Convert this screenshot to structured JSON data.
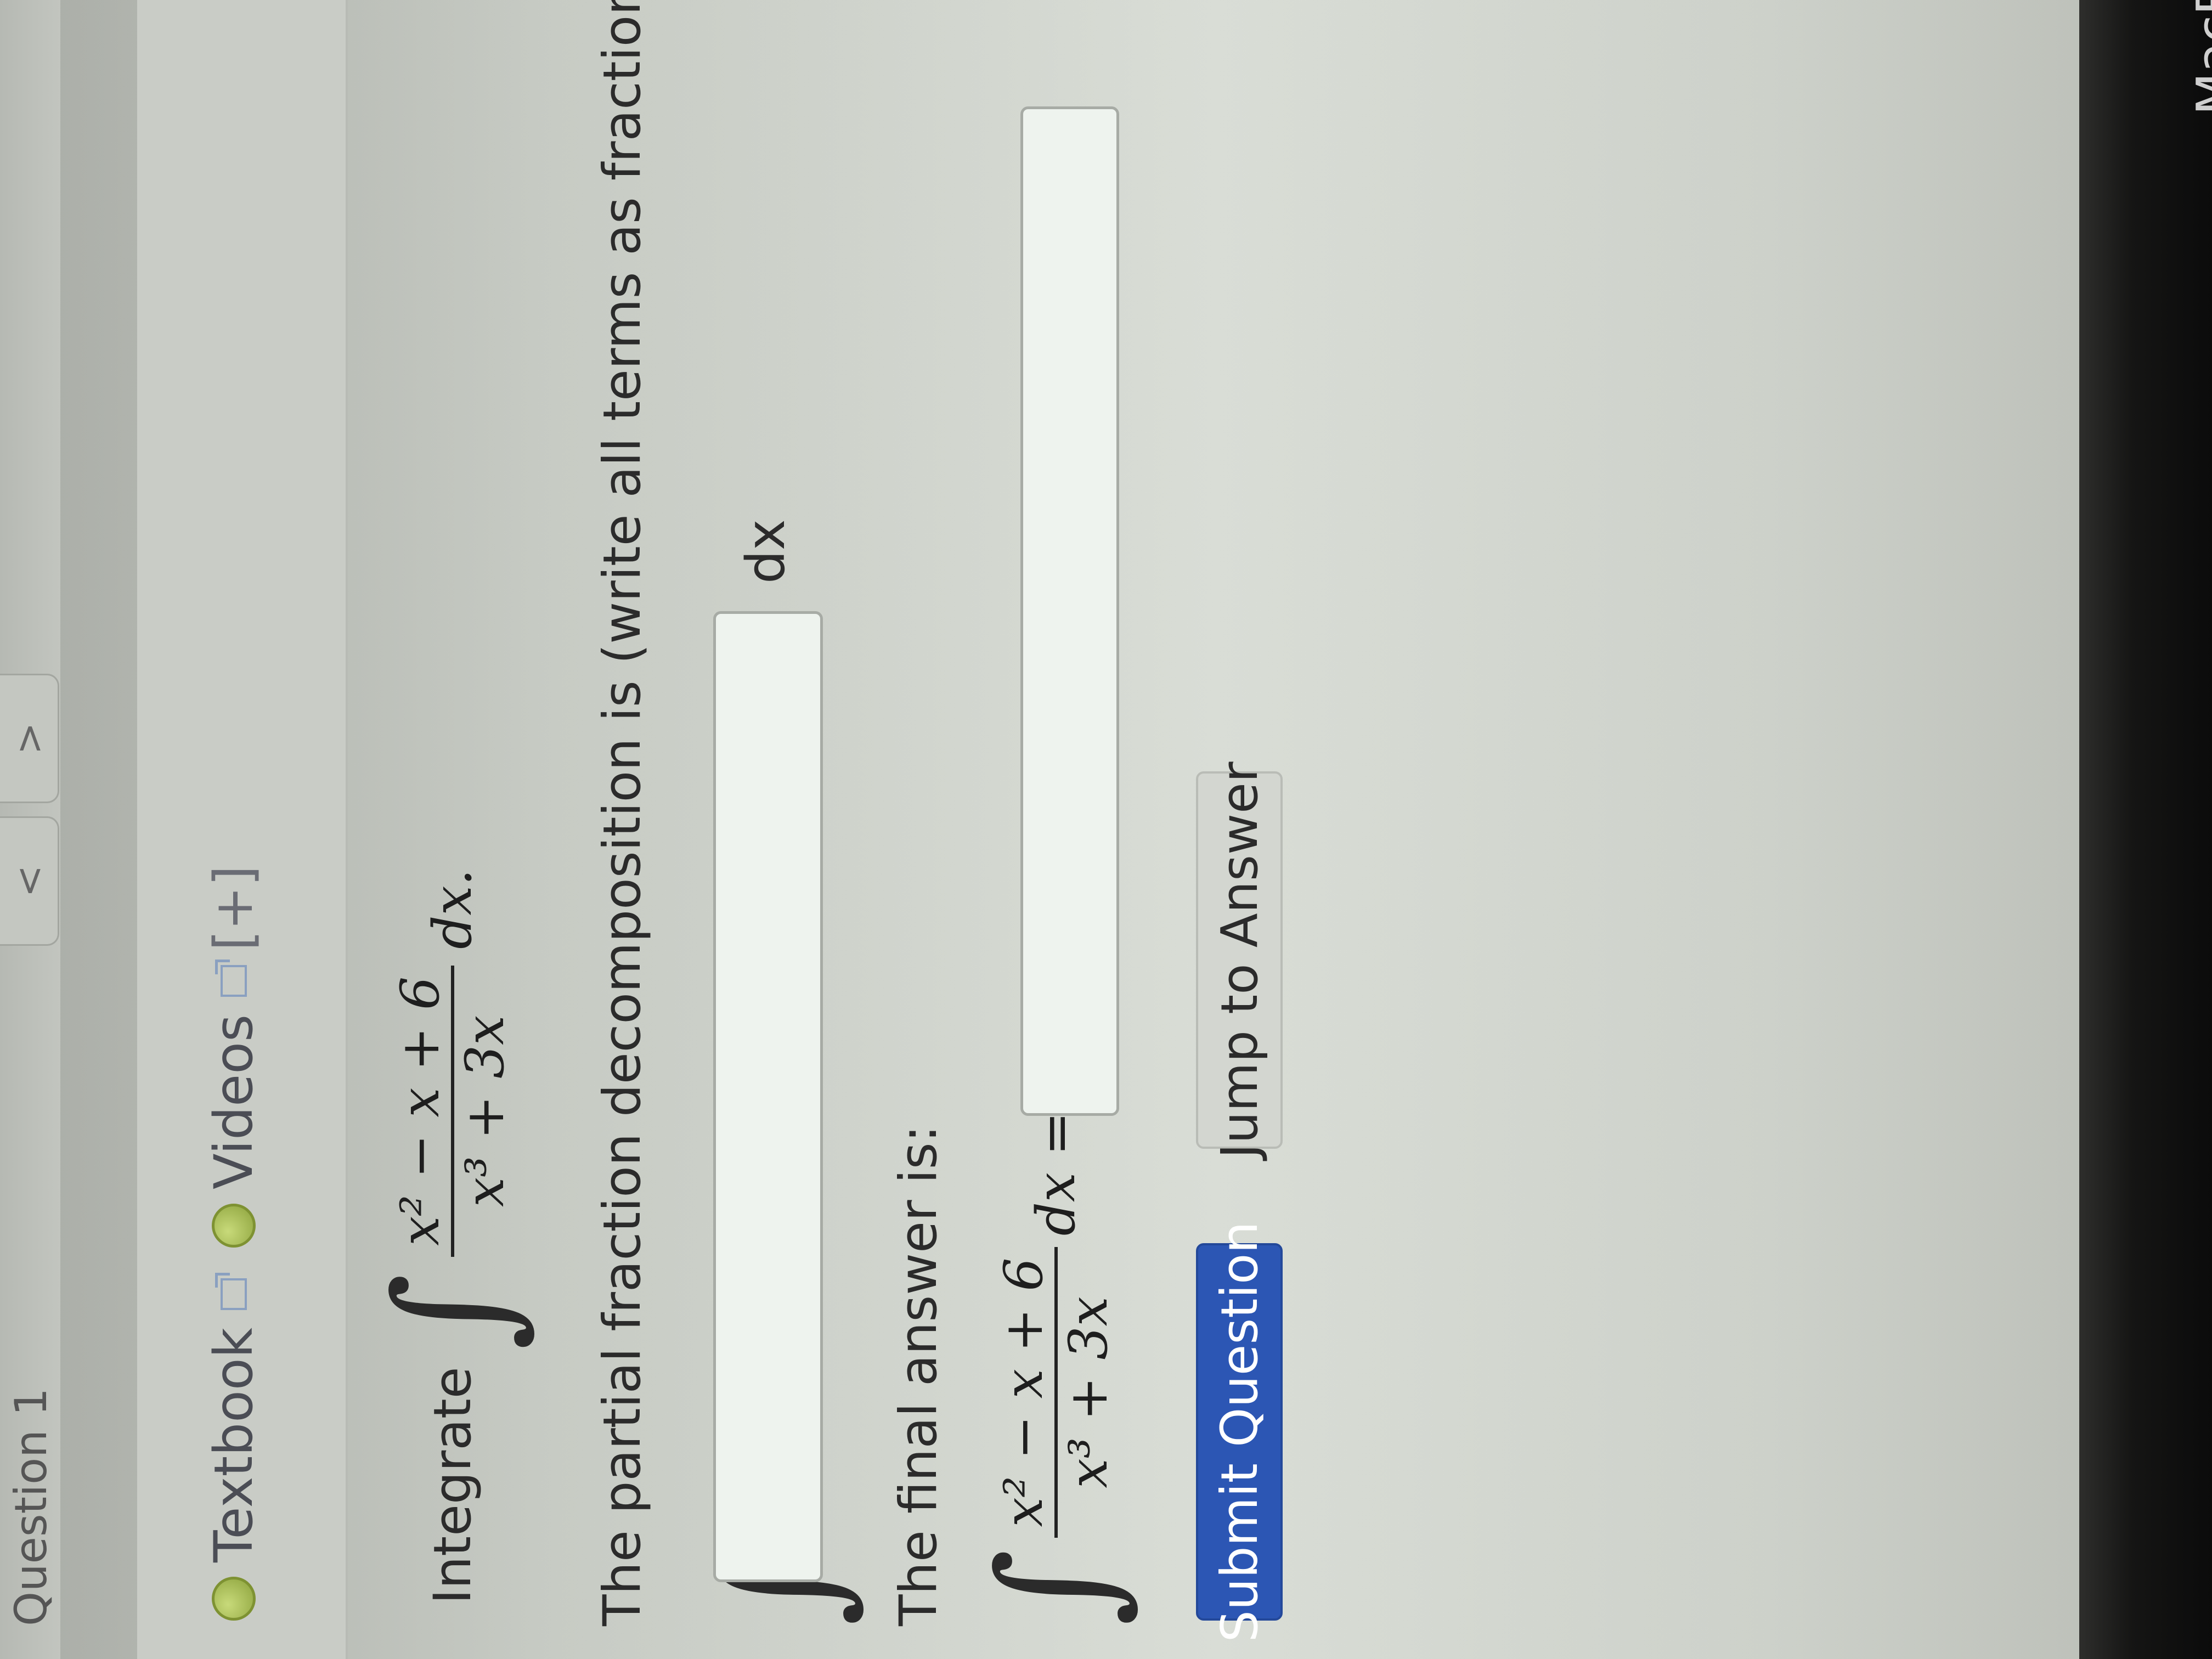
{
  "header": {
    "question_label": "Question 1",
    "tab_prev": "<",
    "tab_next": ">"
  },
  "toolbar": {
    "textbook_label": "Textbook",
    "videos_label": "Videos",
    "videos_expand": "[+]"
  },
  "problem": {
    "prompt_word": "Integrate",
    "numerator": "x² − x + 6",
    "denominator": "x³ + 3x",
    "differential": "dx."
  },
  "partial_fraction": {
    "instruction": "The partial fraction decomposition is (write all terms as fractions):",
    "input_value": "",
    "suffix": "dx"
  },
  "final_answer": {
    "label": "The final answer is:",
    "numerator": "x² − x + 6",
    "denominator": "x³ + 3x",
    "differential": "dx =",
    "input_value": ""
  },
  "buttons": {
    "submit": "Submit Question",
    "jump": "Jump to Answer"
  },
  "bezel": {
    "brand_text": "MacB"
  }
}
